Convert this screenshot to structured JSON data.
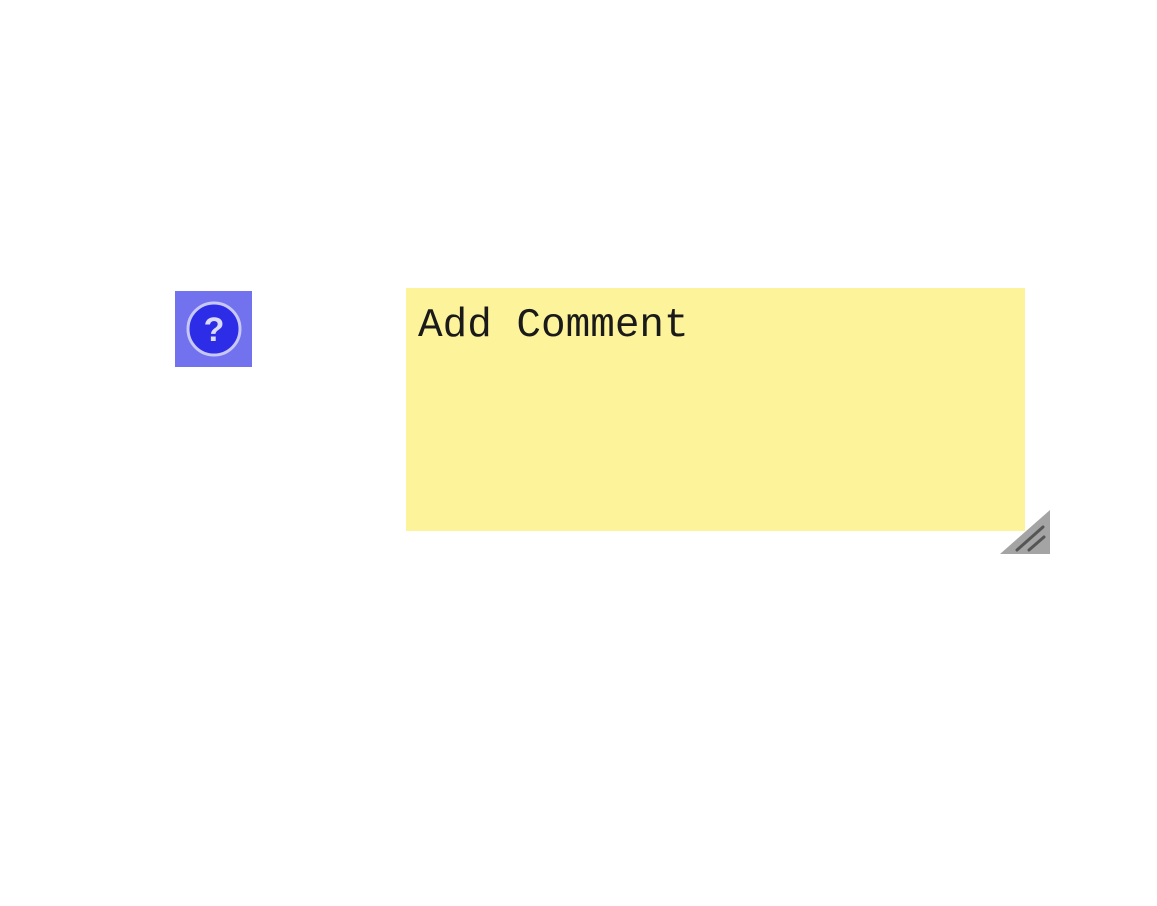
{
  "help": {
    "icon": "question-circle-icon",
    "glyph": "?",
    "tile_color": "#7272ef",
    "circle_color": "#2d2de8",
    "ring_color": "#c8c8f8"
  },
  "comment": {
    "placeholder": "Add Comment",
    "value": "",
    "note_color": "#fdf39b"
  },
  "resize_handle": {
    "icon": "resize-grip-icon",
    "color": "#a4a4a4"
  }
}
